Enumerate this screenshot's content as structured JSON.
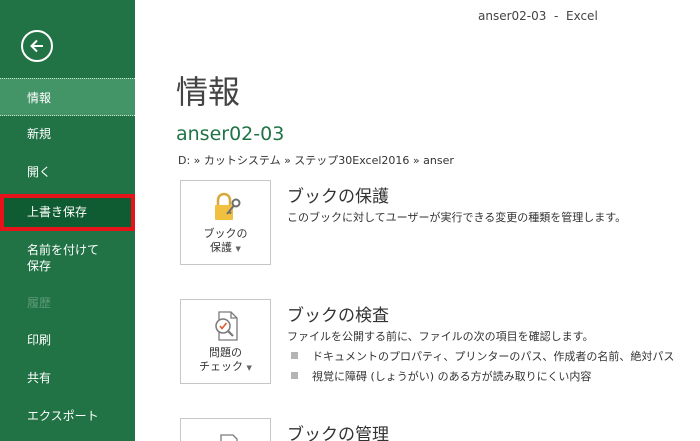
{
  "window": {
    "title": "anser02-03  -  Excel"
  },
  "sidebar": {
    "back_label": "",
    "items": [
      {
        "label": "情報"
      },
      {
        "label": "新規"
      },
      {
        "label": "開く"
      },
      {
        "label": "上書き保存"
      },
      {
        "label": "名前を付けて",
        "label2": "保存"
      },
      {
        "label": "履歴"
      },
      {
        "label": "印刷"
      },
      {
        "label": "共有"
      },
      {
        "label": "エクスポート"
      }
    ]
  },
  "main": {
    "title": "情報",
    "doc_name": "anser02-03",
    "path": "D: » カットシステム » ステップ30Excel2016 » anser",
    "sections": [
      {
        "title": "ブックの保護",
        "desc": "このブックに対してユーザーが実行できる変更の種類を管理します。",
        "button_line1": "ブックの",
        "button_line2": "保護"
      },
      {
        "title": "ブックの検査",
        "desc": "ファイルを公開する前に、ファイルの次の項目を確認します。",
        "button_line1": "問題の",
        "button_line2": "チェック",
        "bullets": [
          "ドキュメントのプロパティ、プリンターのパス、作成者の名前、絶対パス",
          "視覚に障碍 (しょうがい) のある方が読み取りにくい内容"
        ]
      },
      {
        "title": "ブックの管理"
      }
    ]
  },
  "colors": {
    "accent": "#217346",
    "highlight": "#e5141b"
  }
}
